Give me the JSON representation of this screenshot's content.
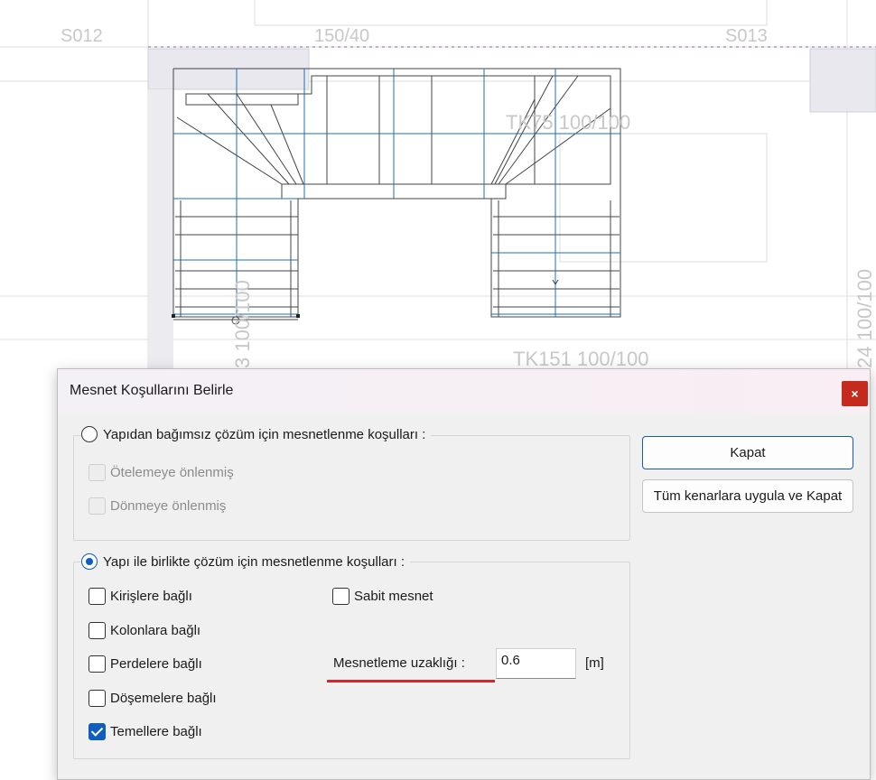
{
  "background": {
    "labels": {
      "s012": "S012",
      "dim_150_40": "150/40",
      "s013": "S013",
      "tk75": "TK75 100/100",
      "tk151": "TK151 100/100",
      "left_vertical": "3 100/100",
      "right_vertical": "24 100/100"
    }
  },
  "dialog": {
    "title": "Mesnet Koşullarını Belirle",
    "close_glyph": "×",
    "group1": {
      "radio_label": "Yapıdan bağımsız çözüm için mesnetlenme koşulları  :",
      "selected": false,
      "checkboxes": [
        {
          "label": "Ötelemeye önlenmiş",
          "checked": false,
          "enabled": false
        },
        {
          "label": "Dönmeye önlenmiş",
          "checked": false,
          "enabled": false
        }
      ]
    },
    "group2": {
      "radio_label": "Yapı ile birlikte çözüm için mesnetlenme koşulları  :",
      "selected": true,
      "checkboxes": [
        {
          "label": "Kirişlere bağlı",
          "checked": false
        },
        {
          "label": "Kolonlara bağlı",
          "checked": false
        },
        {
          "label": "Perdelere bağlı",
          "checked": false
        },
        {
          "label": "Döşemelere bağlı",
          "checked": false
        },
        {
          "label": "Temellere bağlı",
          "checked": true
        }
      ],
      "sabit_mesnet": {
        "label": "Sabit mesnet",
        "checked": false
      },
      "distance": {
        "label": "Mesnetleme uzaklığı :",
        "value": "0.6",
        "unit": "[m]"
      }
    },
    "buttons": {
      "close_label": "Kapat",
      "apply_all_label": "Tüm kenarlara uygula ve Kapat"
    },
    "colors": {
      "accent": "#0f5dbd",
      "close_red": "#c42b1c",
      "underline_red": "#d9242b"
    }
  }
}
